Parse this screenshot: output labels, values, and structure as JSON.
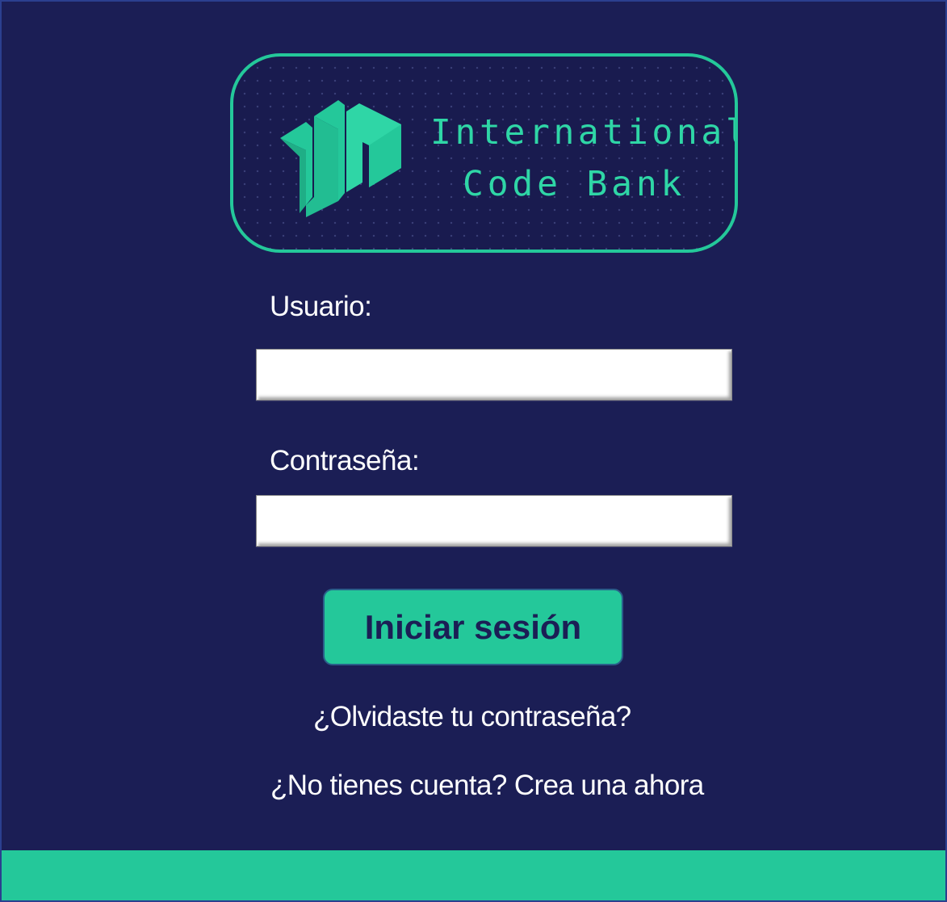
{
  "brand": {
    "name_line_1": "International",
    "name_line_2": "Code Bank",
    "logo_icon": "icb-logo-icon",
    "accent_color": "#24c89a",
    "background_color": "#1b1e55"
  },
  "form": {
    "username_label": "Usuario:",
    "username_value": "",
    "password_label": "Contraseña:",
    "password_value": "",
    "submit_label": "Iniciar sesión"
  },
  "links": {
    "forgot_password": "¿Olvidaste tu contraseña?",
    "create_account": "¿No tienes cuenta? Crea una ahora"
  }
}
